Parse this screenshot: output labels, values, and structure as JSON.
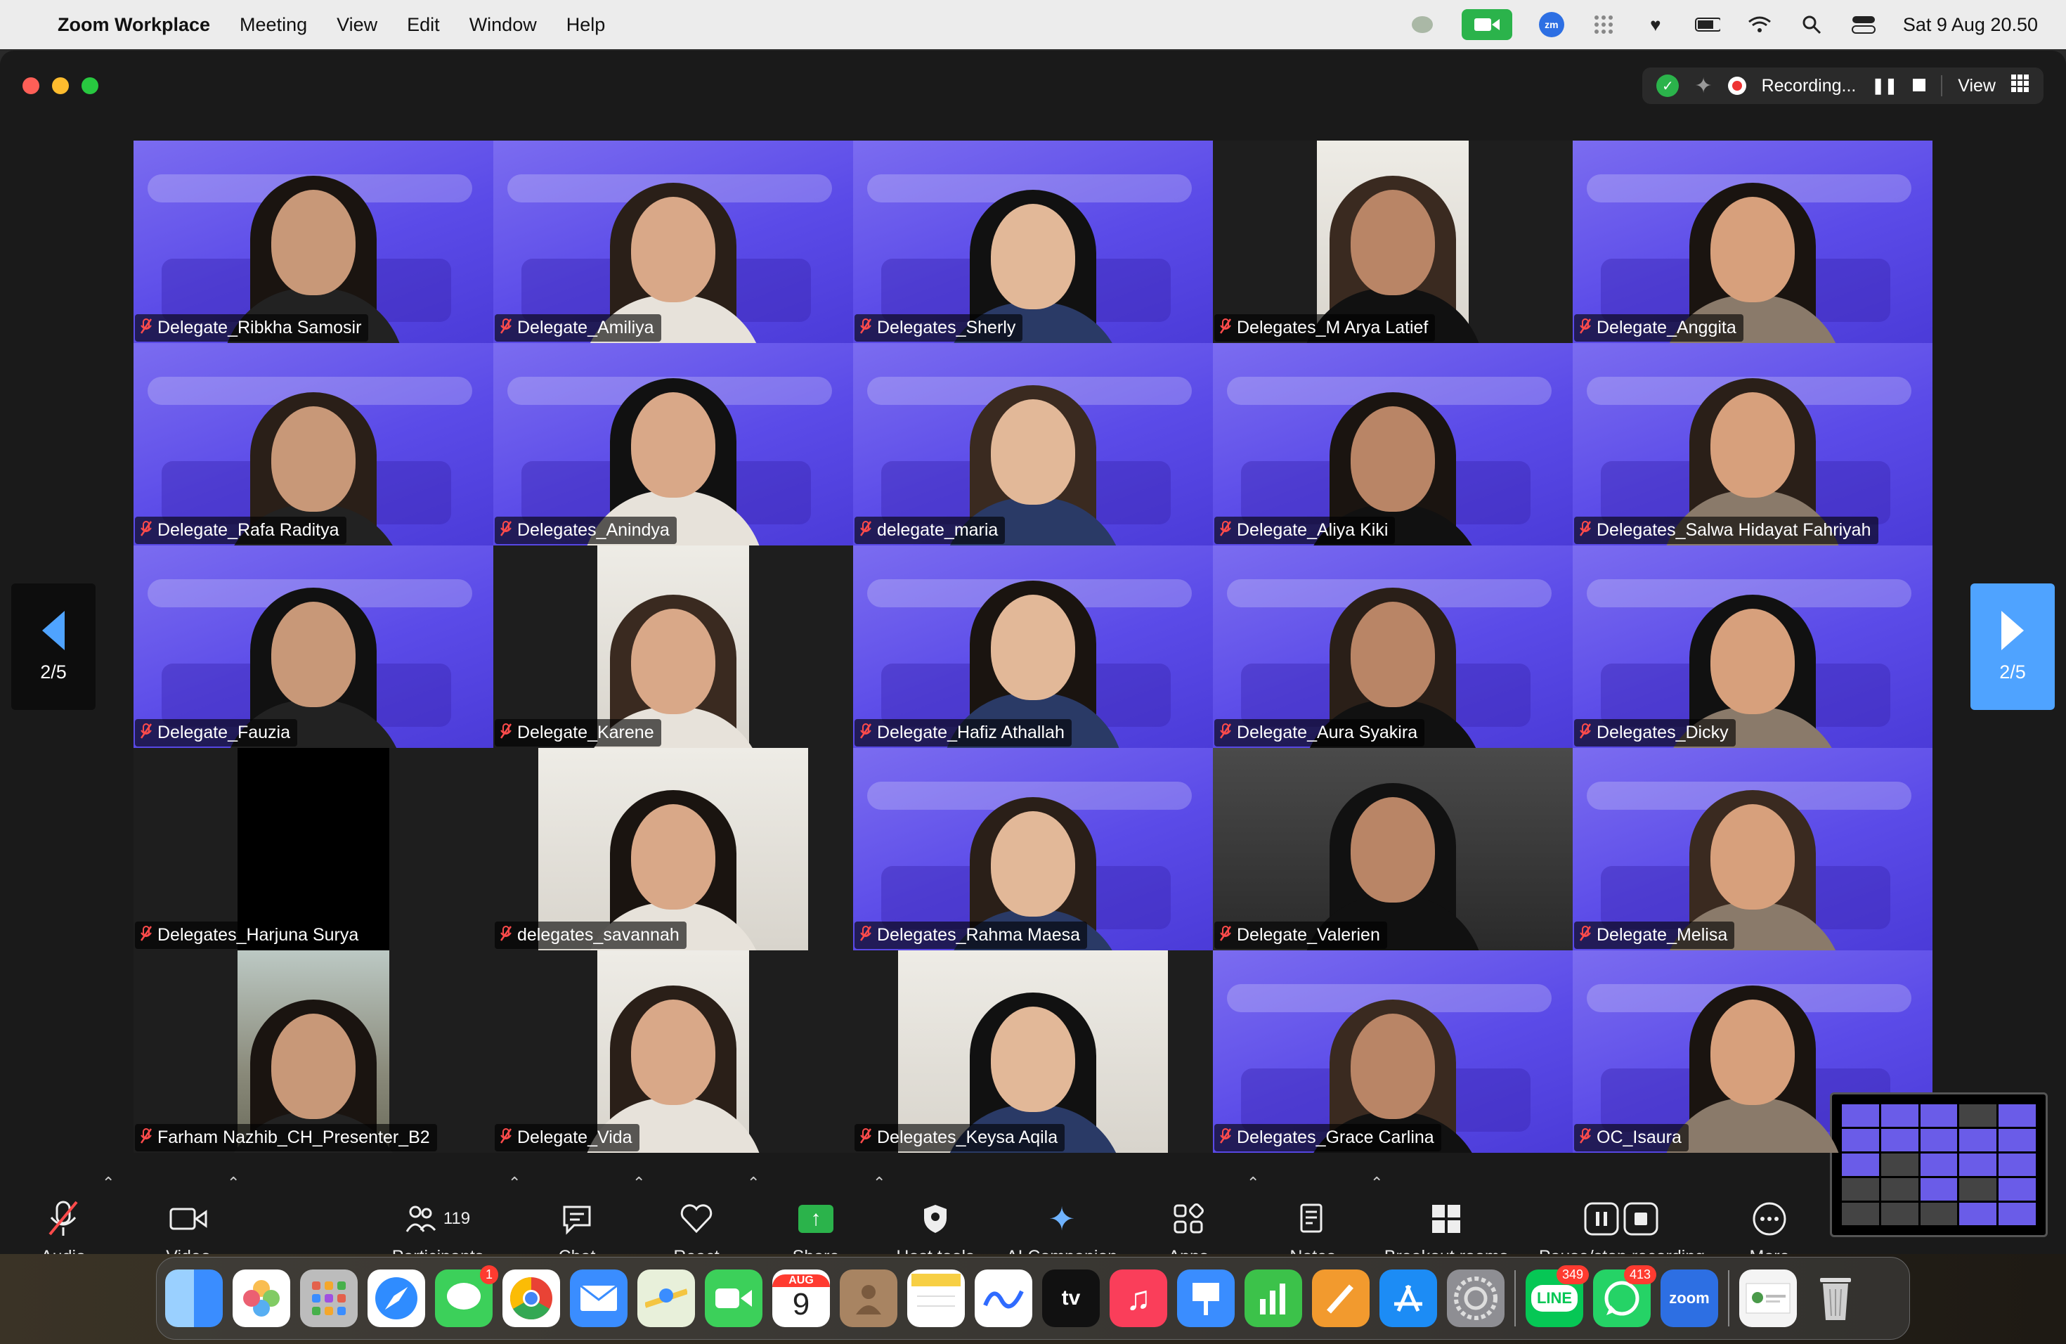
{
  "menubar": {
    "apple": "",
    "app_name": "Zoom Workplace",
    "menus": [
      "Meeting",
      "View",
      "Edit",
      "Window",
      "Help"
    ],
    "datetime": "Sat 9 Aug  20.50",
    "zm_label": "zm"
  },
  "titlebar": {
    "recording": "Recording...",
    "view": "View"
  },
  "nav": {
    "left_page": "2/5",
    "right_page": "2/5"
  },
  "participants": [
    {
      "name": "Delegate_Ribkha Samosir",
      "bg": "purple"
    },
    {
      "name": "Delegate_Amiliya",
      "bg": "purple"
    },
    {
      "name": "Delegates_Sherly",
      "bg": "purple"
    },
    {
      "name": "Delegates_M Arya Latief",
      "bg": "white"
    },
    {
      "name": "Delegate_Anggita",
      "bg": "purple"
    },
    {
      "name": "Delegate_Rafa Raditya",
      "bg": "purple"
    },
    {
      "name": "Delegates_Anindya",
      "bg": "purple"
    },
    {
      "name": "delegate_maria",
      "bg": "purple"
    },
    {
      "name": "Delegate_Aliya Kiki",
      "bg": "purple"
    },
    {
      "name": "Delegates_Salwa Hidayat Fahriyah",
      "bg": "purple"
    },
    {
      "name": "Delegate_Fauzia",
      "bg": "purple"
    },
    {
      "name": "Delegate_Karene",
      "bg": "white"
    },
    {
      "name": "Delegate_Hafiz Athallah",
      "bg": "purple"
    },
    {
      "name": "Delegate_Aura Syakira",
      "bg": "purple"
    },
    {
      "name": "Delegates_Dicky",
      "bg": "purple"
    },
    {
      "name": "Delegates_Harjuna Surya",
      "bg": "black"
    },
    {
      "name": "delegates_savannah",
      "bg": "white"
    },
    {
      "name": "Delegates_Rahma Maesa",
      "bg": "purple"
    },
    {
      "name": "Delegate_Valerien",
      "bg": "dark"
    },
    {
      "name": "Delegate_Melisa",
      "bg": "purple"
    },
    {
      "name": "Farham Nazhib_CH_Presenter_B2",
      "bg": "outdoor"
    },
    {
      "name": "Delegate_Vida",
      "bg": "white"
    },
    {
      "name": "Delegates_Keysa Aqila",
      "bg": "white"
    },
    {
      "name": "Delegates_Grace Carlina",
      "bg": "purple"
    },
    {
      "name": "OC_Isaura",
      "bg": "purple"
    }
  ],
  "toolbar": {
    "audio": "Audio",
    "video": "Video",
    "participants": "Participants",
    "participants_count": "119",
    "chat": "Chat",
    "react": "React",
    "share": "Share",
    "host_tools": "Host tools",
    "ai_companion": "AI Companion",
    "apps": "Apps",
    "notes": "Notes",
    "breakout_rooms": "Breakout rooms",
    "pause_stop_recording": "Pause/stop recording",
    "more": "More"
  },
  "dock": {
    "messages_badge": "1",
    "calendar_month": "AUG",
    "calendar_day": "9",
    "tv_label": "tv",
    "line_badge": "349",
    "line_label": "LINE",
    "whatsapp_badge": "413",
    "zoom_label": "zoom"
  }
}
